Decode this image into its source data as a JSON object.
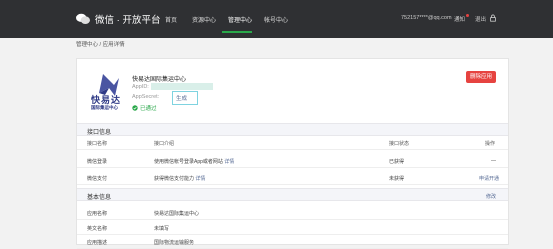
{
  "topbar": {
    "logo_text": "微信 · 开放平台",
    "nav": [
      "首页",
      "资源中心",
      "管理中心",
      "帐号中心"
    ],
    "active_nav_index": 2,
    "user": "752157****@qq.com",
    "notice": "通知",
    "logout": "退出"
  },
  "breadcrumb": "管理中心 / 应用详情",
  "app": {
    "name": "快易达国际集运中心",
    "appid_label": "AppID:",
    "appsecret_label": "AppSecret:",
    "secret_link": "生成",
    "status": "已通过",
    "logo_caption_top": "快易达",
    "logo_caption_bottom": "国际集运中心",
    "delete_label": "删除应用"
  },
  "interfaces": {
    "title": "接口信息",
    "headers": [
      "接口名称",
      "接口介绍",
      "接口状态",
      "操作"
    ],
    "rows": [
      {
        "name": "微信登录",
        "desc": "使用微信帐号登录App或者网站",
        "desc_link": "详情",
        "status": "已获得",
        "action": "—"
      },
      {
        "name": "微信支付",
        "desc": "获得微信支付能力",
        "desc_link": "详情",
        "status": "未获得",
        "action": "申请开通"
      }
    ]
  },
  "basic": {
    "title": "基本信息",
    "edit": "修改",
    "rows": [
      {
        "label": "应用名称",
        "value": "快易达国际集运中心"
      },
      {
        "label": "英文名称",
        "value": "未填写"
      },
      {
        "label": "应用描述",
        "value": "国际物流运输服务"
      }
    ]
  },
  "colors": {
    "topbar_bg": "#2f3033",
    "accent_green": "#2aa84a",
    "danger_red": "#e64340",
    "link_blue": "#576b95"
  }
}
